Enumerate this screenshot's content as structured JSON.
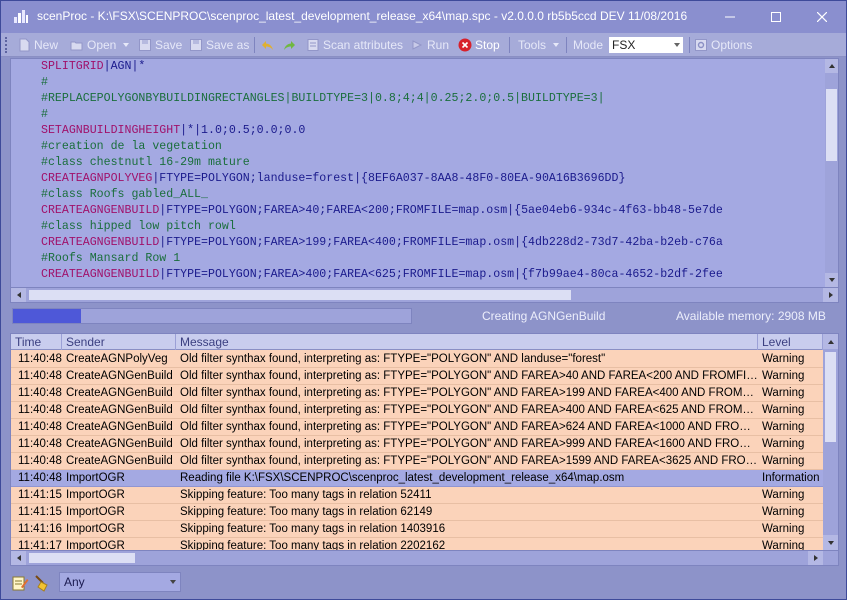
{
  "window": {
    "title": "scenProc - K:\\FSX\\SCENPROC\\scenproc_latest_development_release_x64\\map.spc - v2.0.0.0 rb5b5ccd DEV 11/08/2016"
  },
  "toolbar": {
    "new_label": "New",
    "open_label": "Open",
    "save_label": "Save",
    "save_as_label": "Save as",
    "scan_label": "Scan attributes",
    "run_label": "Run",
    "stop_label": "Stop",
    "tools_label": "Tools",
    "mode_label": "Mode",
    "mode_value": "FSX",
    "options_label": "Options"
  },
  "editor": {
    "lines": [
      [
        {
          "t": "SPLITGRID",
          "c": "kw"
        },
        {
          "t": "|AGN|*",
          "c": "tx"
        }
      ],
      [
        {
          "t": "#",
          "c": "cm"
        }
      ],
      [
        {
          "t": "#REPLACEPOLYGONBYBUILDINGRECTANGLES|BUILDTYPE=3|0.8;4;4|0.25;2.0;0.5|BUILDTYPE=3|",
          "c": "cm"
        }
      ],
      [
        {
          "t": "#",
          "c": "cm"
        }
      ],
      [
        {
          "t": "SETAGNBUILDINGHEIGHT",
          "c": "kw"
        },
        {
          "t": "|*|1.0;0.5;0.0;0.0",
          "c": "tx"
        }
      ],
      [
        {
          "t": "#creation de la vegetation",
          "c": "cm"
        }
      ],
      [
        {
          "t": "#class chestnutl 16-29m mature",
          "c": "cm"
        }
      ],
      [
        {
          "t": "CREATEAGNPOLYVEG",
          "c": "kw"
        },
        {
          "t": "|FTYPE=POLYGON;landuse=forest|{8EF6A037-8AA8-48F0-80EA-90A16B3696DD}",
          "c": "tx"
        }
      ],
      [
        {
          "t": "#class Roofs gabled_ALL_",
          "c": "cm"
        }
      ],
      [
        {
          "t": "CREATEAGNGENBUILD",
          "c": "kw"
        },
        {
          "t": "|FTYPE=POLYGON;FAREA>40;FAREA<200;FROMFILE=map.osm|{5ae04eb6-934c-4f63-bb48-5e7de",
          "c": "tx"
        }
      ],
      [
        {
          "t": "#class hipped low pitch rowl",
          "c": "cm"
        }
      ],
      [
        {
          "t": "CREATEAGNGENBUILD",
          "c": "kw"
        },
        {
          "t": "|FTYPE=POLYGON;FAREA>199;FAREA<400;FROMFILE=map.osm|{4db228d2-73d7-42ba-b2eb-c76a",
          "c": "tx"
        }
      ],
      [
        {
          "t": "#Roofs Mansard Row 1",
          "c": "cm"
        }
      ],
      [
        {
          "t": "CREATEAGNGENBUILD",
          "c": "kw"
        },
        {
          "t": "|FTYPE=POLYGON;FAREA>400;FAREA<625;FROMFILE=map.osm|{f7b99ae4-80ca-4652-b2df-2fee",
          "c": "tx"
        }
      ]
    ]
  },
  "status": {
    "progress_fraction": 0.17,
    "text": "Creating AGNGenBuild",
    "memory": "Available memory: 2908 MB"
  },
  "log": {
    "columns": [
      "Time",
      "Sender",
      "Message",
      "Level"
    ],
    "rows": [
      {
        "time": "11:40:48",
        "sender": "CreateAGNPolyVeg",
        "message": "Old filter synthax found, interpreting as: FTYPE=\"POLYGON\" AND landuse=\"forest\"",
        "level": "Warning",
        "kind": "warn"
      },
      {
        "time": "11:40:48",
        "sender": "CreateAGNGenBuild",
        "message": "Old filter synthax found, interpreting as: FTYPE=\"POLYGON\" AND FAREA>40 AND FAREA<200 AND FROMFILE=\"m...",
        "level": "Warning",
        "kind": "warn"
      },
      {
        "time": "11:40:48",
        "sender": "CreateAGNGenBuild",
        "message": "Old filter synthax found, interpreting as: FTYPE=\"POLYGON\" AND FAREA>199 AND FAREA<400 AND FROMFILE=\"...",
        "level": "Warning",
        "kind": "warn"
      },
      {
        "time": "11:40:48",
        "sender": "CreateAGNGenBuild",
        "message": "Old filter synthax found, interpreting as: FTYPE=\"POLYGON\" AND FAREA>400 AND FAREA<625 AND FROMFILE=\"...",
        "level": "Warning",
        "kind": "warn"
      },
      {
        "time": "11:40:48",
        "sender": "CreateAGNGenBuild",
        "message": "Old filter synthax found, interpreting as: FTYPE=\"POLYGON\" AND FAREA>624 AND FAREA<1000 AND FROMFILE=...",
        "level": "Warning",
        "kind": "warn"
      },
      {
        "time": "11:40:48",
        "sender": "CreateAGNGenBuild",
        "message": "Old filter synthax found, interpreting as: FTYPE=\"POLYGON\" AND FAREA>999 AND FAREA<1600 AND FROMFILE=...",
        "level": "Warning",
        "kind": "warn"
      },
      {
        "time": "11:40:48",
        "sender": "CreateAGNGenBuild",
        "message": "Old filter synthax found, interpreting as: FTYPE=\"POLYGON\" AND FAREA>1599 AND FAREA<3625 AND FROMFILE=...",
        "level": "Warning",
        "kind": "warn"
      },
      {
        "time": "11:40:48",
        "sender": "ImportOGR",
        "message": "Reading file K:\\FSX\\SCENPROC\\scenproc_latest_development_release_x64\\map.osm",
        "level": "Information",
        "kind": "info"
      },
      {
        "time": "11:41:15",
        "sender": "ImportOGR",
        "message": "Skipping feature: Too many tags in relation 52411",
        "level": "Warning",
        "kind": "warn"
      },
      {
        "time": "11:41:15",
        "sender": "ImportOGR",
        "message": "Skipping feature: Too many tags in relation 62149",
        "level": "Warning",
        "kind": "warn"
      },
      {
        "time": "11:41:16",
        "sender": "ImportOGR",
        "message": "Skipping feature: Too many tags in relation 1403916",
        "level": "Warning",
        "kind": "warn"
      },
      {
        "time": "11:41:17",
        "sender": "ImportOGR",
        "message": "Skipping feature: Too many tags in relation 2202162",
        "level": "Warning",
        "kind": "warn"
      }
    ]
  },
  "filter": {
    "value": "Any"
  },
  "colors": {
    "accent": "#8a8fcf",
    "warning_row": "#fbd3ba",
    "info_row": "#a4a9e2",
    "progress_fill": "#4e58d8"
  }
}
